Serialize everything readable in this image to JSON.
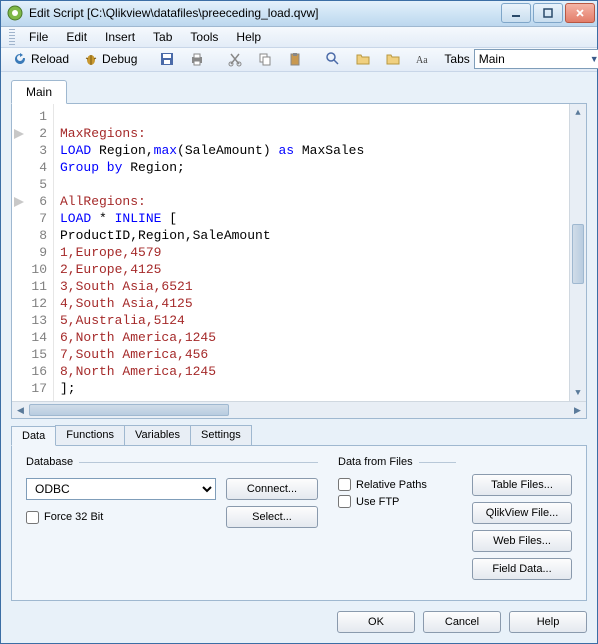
{
  "window": {
    "title": "Edit Script [C:\\Qlikview\\datafiles\\preeceding_load.qvw]"
  },
  "menu": {
    "file": "File",
    "edit": "Edit",
    "insert": "Insert",
    "tab": "Tab",
    "tools": "Tools",
    "help": "Help"
  },
  "toolbar": {
    "reload": "Reload",
    "debug": "Debug",
    "tabs_label": "Tabs",
    "tabs_value": "Main"
  },
  "editor": {
    "tab_label": "Main",
    "lines": [
      {
        "n": 1,
        "sec": false,
        "tokens": []
      },
      {
        "n": 2,
        "sec": true,
        "tokens": [
          [
            "lbl",
            "MaxRegions:"
          ]
        ]
      },
      {
        "n": 3,
        "sec": false,
        "tokens": [
          [
            "kw",
            "LOAD"
          ],
          [
            "ident",
            " Region,"
          ],
          [
            "fn",
            "max"
          ],
          [
            "ident",
            "(SaleAmount) "
          ],
          [
            "kw",
            "as"
          ],
          [
            "ident",
            " MaxSales"
          ]
        ]
      },
      {
        "n": 4,
        "sec": false,
        "tokens": [
          [
            "kw",
            "Group by"
          ],
          [
            "ident",
            " Region;"
          ]
        ]
      },
      {
        "n": 5,
        "sec": false,
        "tokens": []
      },
      {
        "n": 6,
        "sec": true,
        "tokens": [
          [
            "lbl",
            "AllRegions:"
          ]
        ]
      },
      {
        "n": 7,
        "sec": false,
        "tokens": [
          [
            "kw",
            "LOAD"
          ],
          [
            "ident",
            " * "
          ],
          [
            "kw",
            "INLINE"
          ],
          [
            "ident",
            " ["
          ]
        ]
      },
      {
        "n": 8,
        "sec": false,
        "tokens": [
          [
            "ident",
            "ProductID,Region,SaleAmount"
          ]
        ]
      },
      {
        "n": 9,
        "sec": false,
        "tokens": [
          [
            "dat",
            "1,Europe,4579"
          ]
        ]
      },
      {
        "n": 10,
        "sec": false,
        "tokens": [
          [
            "dat",
            "2,Europe,4125"
          ]
        ]
      },
      {
        "n": 11,
        "sec": false,
        "tokens": [
          [
            "dat",
            "3,South Asia,6521"
          ]
        ]
      },
      {
        "n": 12,
        "sec": false,
        "tokens": [
          [
            "dat",
            "4,South Asia,4125"
          ]
        ]
      },
      {
        "n": 13,
        "sec": false,
        "tokens": [
          [
            "dat",
            "5,Australia,5124"
          ]
        ]
      },
      {
        "n": 14,
        "sec": false,
        "tokens": [
          [
            "dat",
            "6,North America,1245"
          ]
        ]
      },
      {
        "n": 15,
        "sec": false,
        "tokens": [
          [
            "dat",
            "7,South America,456"
          ]
        ]
      },
      {
        "n": 16,
        "sec": false,
        "tokens": [
          [
            "dat",
            "8,North America,1245"
          ]
        ]
      },
      {
        "n": 17,
        "sec": false,
        "tokens": [
          [
            "ident",
            "];"
          ]
        ]
      }
    ]
  },
  "bottom_tabs": {
    "data": "Data",
    "functions": "Functions",
    "variables": "Variables",
    "settings": "Settings"
  },
  "panel": {
    "database_label": "Database",
    "odbc": "ODBC",
    "connect": "Connect...",
    "select": "Select...",
    "force32": "Force 32 Bit",
    "files_label": "Data from Files",
    "relative_paths": "Relative Paths",
    "use_ftp": "Use FTP",
    "table_files": "Table Files...",
    "qlikview_file": "QlikView File...",
    "web_files": "Web Files...",
    "field_data": "Field Data..."
  },
  "dialog": {
    "ok": "OK",
    "cancel": "Cancel",
    "help": "Help"
  }
}
